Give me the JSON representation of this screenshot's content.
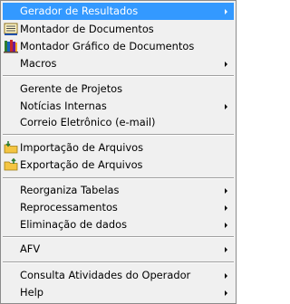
{
  "menu": {
    "items": [
      {
        "label": "Gerador de Resultados",
        "submenu": true,
        "selected": true
      },
      {
        "label": "Montador de Documentos",
        "icon": "document-list-icon"
      },
      {
        "label": "Montador Gráfico de Documentos",
        "icon": "books-icon"
      },
      {
        "label": "Macros",
        "submenu": true
      },
      {
        "label": "Gerente de Projetos"
      },
      {
        "label": "Notícias Internas",
        "submenu": true
      },
      {
        "label": "Correio Eletrônico (e-mail)"
      },
      {
        "label": "Importação de Arquivos",
        "icon": "folder-import-icon"
      },
      {
        "label": "Exportação de Arquivos",
        "icon": "folder-export-icon"
      },
      {
        "label": "Reorganiza Tabelas",
        "submenu": true
      },
      {
        "label": "Reprocessamentos",
        "submenu": true
      },
      {
        "label": "Eliminação de dados",
        "submenu": true
      },
      {
        "label": "AFV",
        "submenu": true
      },
      {
        "label": "Consulta Atividades do Operador",
        "submenu": true
      },
      {
        "label": "Help",
        "submenu": true
      }
    ]
  },
  "colors": {
    "menu_background": "#f0f0f0",
    "selection": "#3399ff",
    "border": "#8b8b8b"
  }
}
